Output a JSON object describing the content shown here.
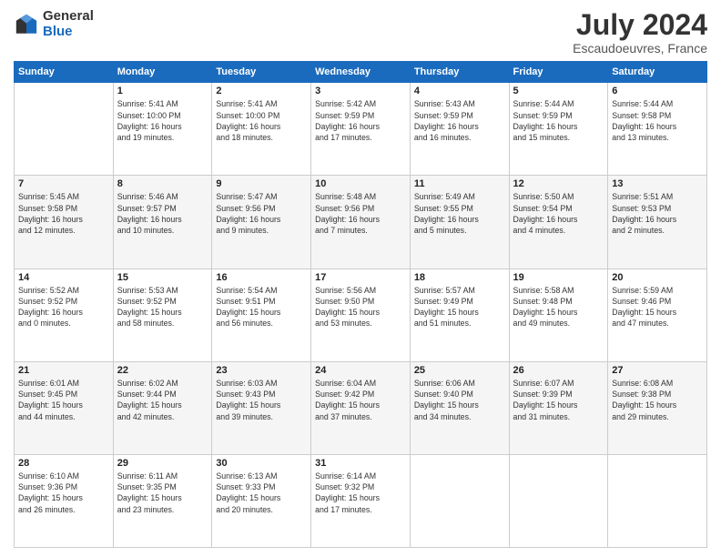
{
  "logo": {
    "general": "General",
    "blue": "Blue"
  },
  "title": "July 2024",
  "subtitle": "Escaudoeuvres, France",
  "days_header": [
    "Sunday",
    "Monday",
    "Tuesday",
    "Wednesday",
    "Thursday",
    "Friday",
    "Saturday"
  ],
  "weeks": [
    [
      {
        "num": "",
        "info": ""
      },
      {
        "num": "1",
        "info": "Sunrise: 5:41 AM\nSunset: 10:00 PM\nDaylight: 16 hours\nand 19 minutes."
      },
      {
        "num": "2",
        "info": "Sunrise: 5:41 AM\nSunset: 10:00 PM\nDaylight: 16 hours\nand 18 minutes."
      },
      {
        "num": "3",
        "info": "Sunrise: 5:42 AM\nSunset: 9:59 PM\nDaylight: 16 hours\nand 17 minutes."
      },
      {
        "num": "4",
        "info": "Sunrise: 5:43 AM\nSunset: 9:59 PM\nDaylight: 16 hours\nand 16 minutes."
      },
      {
        "num": "5",
        "info": "Sunrise: 5:44 AM\nSunset: 9:59 PM\nDaylight: 16 hours\nand 15 minutes."
      },
      {
        "num": "6",
        "info": "Sunrise: 5:44 AM\nSunset: 9:58 PM\nDaylight: 16 hours\nand 13 minutes."
      }
    ],
    [
      {
        "num": "7",
        "info": "Sunrise: 5:45 AM\nSunset: 9:58 PM\nDaylight: 16 hours\nand 12 minutes."
      },
      {
        "num": "8",
        "info": "Sunrise: 5:46 AM\nSunset: 9:57 PM\nDaylight: 16 hours\nand 10 minutes."
      },
      {
        "num": "9",
        "info": "Sunrise: 5:47 AM\nSunset: 9:56 PM\nDaylight: 16 hours\nand 9 minutes."
      },
      {
        "num": "10",
        "info": "Sunrise: 5:48 AM\nSunset: 9:56 PM\nDaylight: 16 hours\nand 7 minutes."
      },
      {
        "num": "11",
        "info": "Sunrise: 5:49 AM\nSunset: 9:55 PM\nDaylight: 16 hours\nand 5 minutes."
      },
      {
        "num": "12",
        "info": "Sunrise: 5:50 AM\nSunset: 9:54 PM\nDaylight: 16 hours\nand 4 minutes."
      },
      {
        "num": "13",
        "info": "Sunrise: 5:51 AM\nSunset: 9:53 PM\nDaylight: 16 hours\nand 2 minutes."
      }
    ],
    [
      {
        "num": "14",
        "info": "Sunrise: 5:52 AM\nSunset: 9:52 PM\nDaylight: 16 hours\nand 0 minutes."
      },
      {
        "num": "15",
        "info": "Sunrise: 5:53 AM\nSunset: 9:52 PM\nDaylight: 15 hours\nand 58 minutes."
      },
      {
        "num": "16",
        "info": "Sunrise: 5:54 AM\nSunset: 9:51 PM\nDaylight: 15 hours\nand 56 minutes."
      },
      {
        "num": "17",
        "info": "Sunrise: 5:56 AM\nSunset: 9:50 PM\nDaylight: 15 hours\nand 53 minutes."
      },
      {
        "num": "18",
        "info": "Sunrise: 5:57 AM\nSunset: 9:49 PM\nDaylight: 15 hours\nand 51 minutes."
      },
      {
        "num": "19",
        "info": "Sunrise: 5:58 AM\nSunset: 9:48 PM\nDaylight: 15 hours\nand 49 minutes."
      },
      {
        "num": "20",
        "info": "Sunrise: 5:59 AM\nSunset: 9:46 PM\nDaylight: 15 hours\nand 47 minutes."
      }
    ],
    [
      {
        "num": "21",
        "info": "Sunrise: 6:01 AM\nSunset: 9:45 PM\nDaylight: 15 hours\nand 44 minutes."
      },
      {
        "num": "22",
        "info": "Sunrise: 6:02 AM\nSunset: 9:44 PM\nDaylight: 15 hours\nand 42 minutes."
      },
      {
        "num": "23",
        "info": "Sunrise: 6:03 AM\nSunset: 9:43 PM\nDaylight: 15 hours\nand 39 minutes."
      },
      {
        "num": "24",
        "info": "Sunrise: 6:04 AM\nSunset: 9:42 PM\nDaylight: 15 hours\nand 37 minutes."
      },
      {
        "num": "25",
        "info": "Sunrise: 6:06 AM\nSunset: 9:40 PM\nDaylight: 15 hours\nand 34 minutes."
      },
      {
        "num": "26",
        "info": "Sunrise: 6:07 AM\nSunset: 9:39 PM\nDaylight: 15 hours\nand 31 minutes."
      },
      {
        "num": "27",
        "info": "Sunrise: 6:08 AM\nSunset: 9:38 PM\nDaylight: 15 hours\nand 29 minutes."
      }
    ],
    [
      {
        "num": "28",
        "info": "Sunrise: 6:10 AM\nSunset: 9:36 PM\nDaylight: 15 hours\nand 26 minutes."
      },
      {
        "num": "29",
        "info": "Sunrise: 6:11 AM\nSunset: 9:35 PM\nDaylight: 15 hours\nand 23 minutes."
      },
      {
        "num": "30",
        "info": "Sunrise: 6:13 AM\nSunset: 9:33 PM\nDaylight: 15 hours\nand 20 minutes."
      },
      {
        "num": "31",
        "info": "Sunrise: 6:14 AM\nSunset: 9:32 PM\nDaylight: 15 hours\nand 17 minutes."
      },
      {
        "num": "",
        "info": ""
      },
      {
        "num": "",
        "info": ""
      },
      {
        "num": "",
        "info": ""
      }
    ]
  ]
}
